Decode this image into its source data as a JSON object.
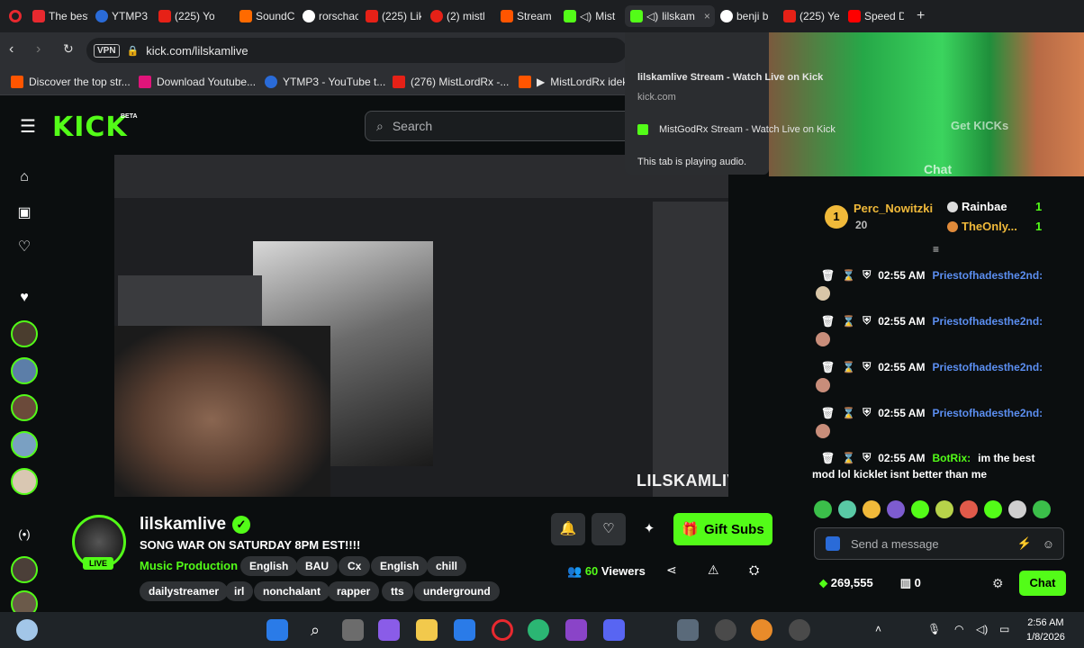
{
  "browser": {
    "tabs": [
      {
        "label": "The best"
      },
      {
        "label": "YTMP3"
      },
      {
        "label": "(225) Yo"
      },
      {
        "label": "SoundC"
      },
      {
        "label": "rorschac"
      },
      {
        "label": "(225) Lik"
      },
      {
        "label": "(2) mistl"
      },
      {
        "label": "Stream"
      },
      {
        "label": "Mist"
      },
      {
        "label": "lilskam"
      },
      {
        "label": "benji b"
      },
      {
        "label": "(225) Ye"
      },
      {
        "label": "Speed D"
      }
    ],
    "vpn_label": "VPN",
    "url": "kick.com/lilskamlive",
    "bookmarks": [
      {
        "label": "Discover the top str..."
      },
      {
        "label": "Download Youtube..."
      },
      {
        "label": "YTMP3 - YouTube t..."
      },
      {
        "label": "(276) MistLordRx -..."
      },
      {
        "label": "MistLordRx idek..."
      }
    ],
    "tab_popup": {
      "title": "lilskamlive Stream - Watch Live on Kick",
      "domain": "kick.com",
      "other_tab": "MistGodRx Stream - Watch Live on Kick",
      "audio_note": "This tab is playing audio."
    }
  },
  "kick": {
    "logo": "KICK",
    "logo_badge": "BETA",
    "search_placeholder": "Search"
  },
  "video": {
    "watermark": "LILSKAMLIVE"
  },
  "channel": {
    "name": "lilskamlive",
    "live_badge": "LIVE",
    "title": "SONG WAR ON SATURDAY 8PM EST!!!!",
    "category": "Music Production",
    "tags_row1": [
      "English",
      "BAU",
      "Cx",
      "English",
      "chill"
    ],
    "tags_row2": [
      "dailystreamer",
      "irl",
      "nonchalant",
      "rapper",
      "tts",
      "underground"
    ],
    "viewers": "60",
    "viewers_label": "Viewers",
    "gift_label": "Gift Subs"
  },
  "chat": {
    "top_gifter": {
      "name": "Perc_Nowitzki",
      "count": "20",
      "rank": "1"
    },
    "gifters": [
      {
        "name": "Rainbae",
        "count": "1"
      },
      {
        "name": "TheOnly...",
        "count": "1"
      }
    ],
    "messages": [
      {
        "time": "02:55 AM",
        "user": "Priestofhadesthe2nd:",
        "text": ""
      },
      {
        "time": "02:55 AM",
        "user": "Priestofhadesthe2nd:",
        "text": ""
      },
      {
        "time": "02:55 AM",
        "user": "Priestofhadesthe2nd:",
        "text": ""
      },
      {
        "time": "02:55 AM",
        "user": "Priestofhadesthe2nd:",
        "text": ""
      },
      {
        "time": "02:55 AM",
        "user": "BotRix:",
        "text": "im the best",
        "text2": "mod lol kicklet isnt better than me"
      }
    ],
    "input_placeholder": "Send a message",
    "points": "269,555",
    "gifts": "0",
    "chat_button": "Chat",
    "overlay_button1": "Get KICKs",
    "overlay_button2": "Chat"
  },
  "taskbar": {
    "time": "2:56 AM",
    "date": "1/8/2026"
  },
  "colors": {
    "accent": "#53fc18",
    "background": "#0b0e0f",
    "username": "#5b8ef0"
  }
}
